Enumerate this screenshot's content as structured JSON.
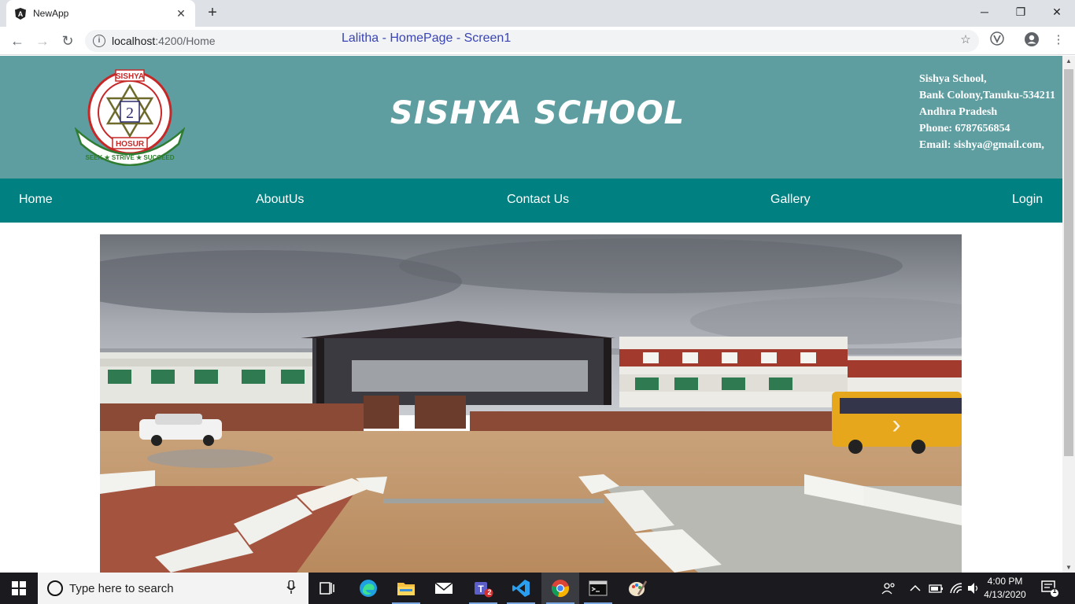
{
  "browser": {
    "tab_title": "NewApp",
    "tab_close": "✕",
    "new_tab": "+",
    "url_host": "localhost",
    "url_path": ":4200/Home",
    "overlay_label": "Lalitha - HomePage - Screen1",
    "window_controls": {
      "minimize": "─",
      "restore": "❐",
      "close": "✕"
    }
  },
  "header": {
    "logo": {
      "top_text": "SISHYA",
      "center_text": "2",
      "bottom_text": "HOSUR",
      "ribbon_text": "SEEK ★ STRIVE ★ SUCCEED"
    },
    "title": "SISHYA SCHOOL",
    "address": [
      "Sishya School,",
      "Bank Colony,Tanuku-534211",
      "Andhra Pradesh",
      "Phone: 6787656854",
      "Email: sishya@gmail.com,"
    ]
  },
  "nav": {
    "home": "Home",
    "about": "AboutUs",
    "contact": "Contact Us",
    "gallery": "Gallery",
    "login": "Login"
  },
  "carousel": {
    "next_glyph": "›"
  },
  "taskbar": {
    "search_placeholder": "Type here to search",
    "time": "4:00 PM",
    "date": "4/13/2020",
    "notification_count": "1",
    "teams_badge": "2"
  }
}
